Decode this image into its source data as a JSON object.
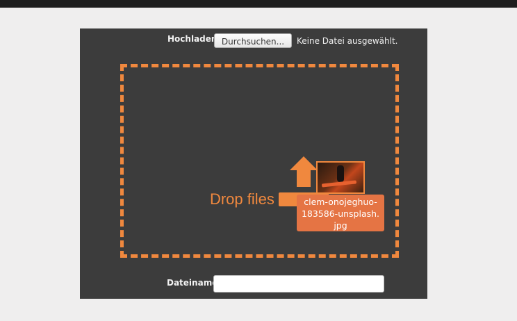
{
  "upload": {
    "label": "Hochladen",
    "browse_label": "Durchsuchen...",
    "no_file_text": "Keine Datei ausgewählt."
  },
  "dropzone": {
    "text": "Drop files here",
    "accent_color": "#f0883e",
    "icon": "upload-arrow-icon"
  },
  "dragged_file": {
    "name_line1": "clem-onojeghuo-",
    "name_line2": "183586-unsplash.",
    "name_line3": "jpg"
  },
  "filename": {
    "label": "Dateiname",
    "value": "",
    "placeholder": ""
  }
}
